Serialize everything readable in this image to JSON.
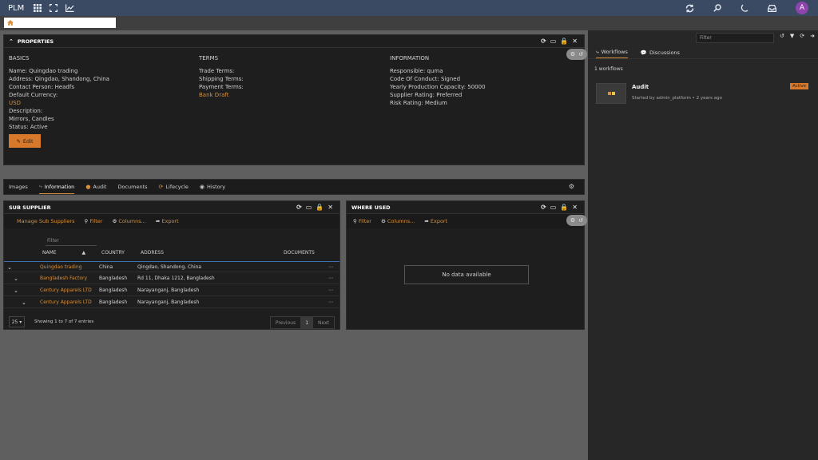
{
  "topbar": {
    "brand": "PLM",
    "avatar_letter": "A"
  },
  "properties": {
    "title": "PROPERTIES",
    "basics": {
      "title": "BASICS",
      "name": "Name: Quingdao trading",
      "address": "Address: Qingdao, Shandong, China",
      "contact": "Contact Person: Headfs",
      "currency_label": "Default Currency:",
      "currency_value": "USD",
      "description_label": "Description:",
      "description_value": "Mirrors, Candles",
      "status": "Status: Active"
    },
    "terms": {
      "title": "TERMS",
      "trade": "Trade Terms:",
      "shipping": "Shipping Terms:",
      "payment_label": "Payment Terms:",
      "payment_value": "Bank Draft"
    },
    "information": {
      "title": "INFORMATION",
      "responsible": "Responsible: quma",
      "code_of_conduct": "Code Of Conduct: Signed",
      "capacity": "Yearly Production Capacity: 50000",
      "supplier_rating": "Supplier Rating: Preferred",
      "risk_rating": "Risk Rating: Medium"
    },
    "edit_label": "Edit"
  },
  "tabs": [
    {
      "label": "Images"
    },
    {
      "label": "Information"
    },
    {
      "label": "Audit"
    },
    {
      "label": "Documents"
    },
    {
      "label": "Lifecycle"
    },
    {
      "label": "History"
    }
  ],
  "sub_supplier": {
    "title": "SUB SUPPLIER",
    "toolbar": {
      "manage": "Manage Sub Suppliers",
      "filter": "Filter",
      "columns": "Columns...",
      "export": "Export"
    },
    "filter_placeholder": "Filter",
    "columns": [
      "NAME",
      "COUNTRY",
      "ADDRESS",
      "DOCUMENTS"
    ],
    "rows": [
      {
        "name": "Quingdao trading",
        "country": "China",
        "address": "Qingdao, Shandong, China"
      },
      {
        "name": "Bangladesh Factory",
        "country": "Bangladesh",
        "address": "Rd 11, Dhaka 1212, Bangladesh"
      },
      {
        "name": "Century Apparels LTD",
        "country": "Bangladesh",
        "address": "Narayanganj, Bangladesh"
      },
      {
        "name": "Century Apparels LTD",
        "country": "Bangladesh",
        "address": "Narayanganj, Bangladesh"
      }
    ],
    "page_size": "25",
    "showing": "Showing 1 to 7 of 7 entries",
    "pager": {
      "previous": "Previous",
      "current": "1",
      "next": "Next"
    }
  },
  "where_used": {
    "title": "WHERE USED",
    "toolbar": {
      "filter": "Filter",
      "columns": "Columns...",
      "export": "Export"
    },
    "empty": "No data available"
  },
  "sidebar": {
    "filter_placeholder": "Filter",
    "tabs": [
      {
        "label": "Workflows"
      },
      {
        "label": "Discussions"
      }
    ],
    "count": "1 workflows",
    "workflow": {
      "title": "Audit",
      "subtitle": "Started by admin_platform • 2 years ago",
      "badge": "Active"
    }
  },
  "colors": {
    "accent": "#d7903b",
    "topbar": "#3a4a63",
    "panel": "#1e1e1e",
    "avatar": "#8e44ad"
  }
}
